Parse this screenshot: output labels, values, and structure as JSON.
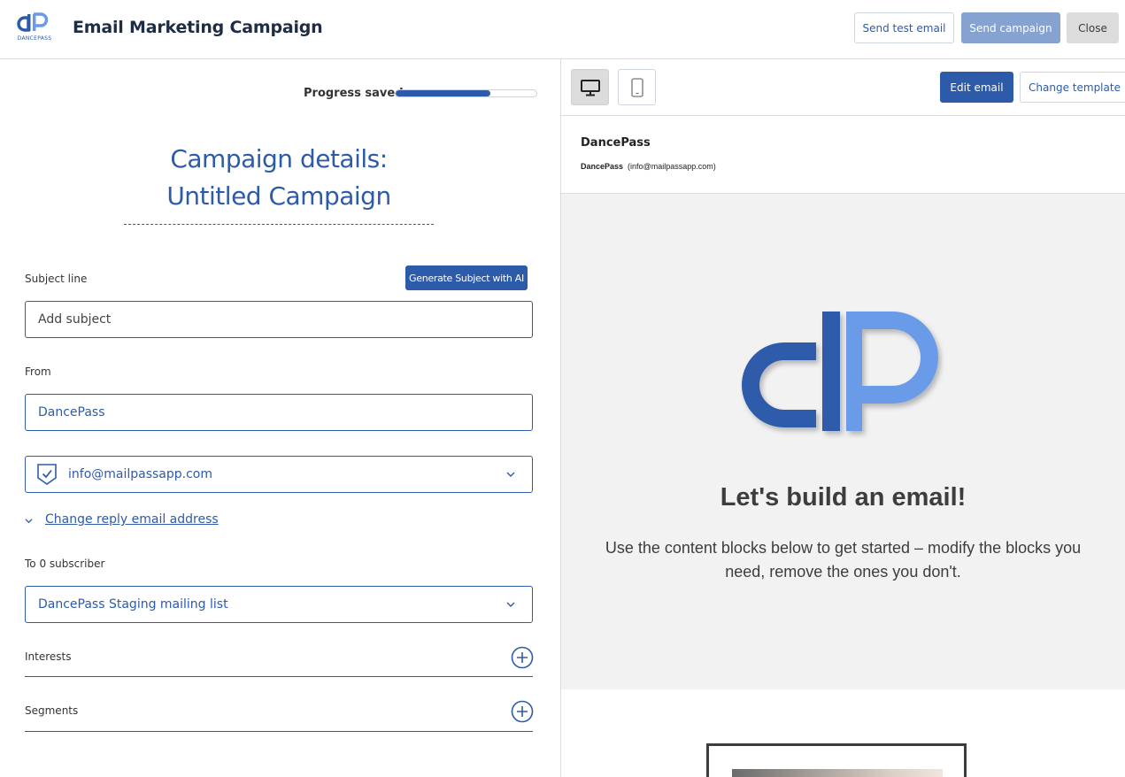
{
  "header": {
    "logo_text": "DANCEPASS",
    "title": "Email Marketing Campaign",
    "send_test_label": "Send test email",
    "send_campaign_label": "Send campaign",
    "close_label": "Close"
  },
  "left": {
    "progress_label": "Progress saved",
    "progress_fraction": 0.67,
    "campaign_title_line1": "Campaign details:",
    "campaign_title_line2": "Untitled Campaign",
    "subject_label": "Subject line",
    "generate_ai_label": "Generate Subject with AI",
    "subject_placeholder": "Add subject",
    "from_label": "From",
    "from_value": "DancePass",
    "from_email": "info@mailpassapp.com",
    "change_reply_label": "Change reply email address",
    "to_label": "To 0 subscriber",
    "mailing_list": "DancePass Staging mailing list",
    "interests_label": "Interests",
    "segments_label": "Segments"
  },
  "right": {
    "edit_email_label": "Edit email",
    "change_template_label": "Change template",
    "sender_name": "DancePass",
    "sender_short": "DancePass",
    "sender_email": "(info@mailpassapp.com)",
    "preview_heading": "Let's build an email!",
    "preview_body": "Use the content blocks below to get started – modify the blocks you need, remove the ones you don't."
  },
  "colors": {
    "brand": "#2d5baa",
    "brand_light": "#6b9be8",
    "send_disabled": "#86a2d0"
  },
  "icons": {
    "desktop": "desktop-icon",
    "mobile": "mobile-icon",
    "shield": "verified-shield-icon",
    "chevron": "chevron-down-icon",
    "plus": "plus-circle-icon"
  }
}
